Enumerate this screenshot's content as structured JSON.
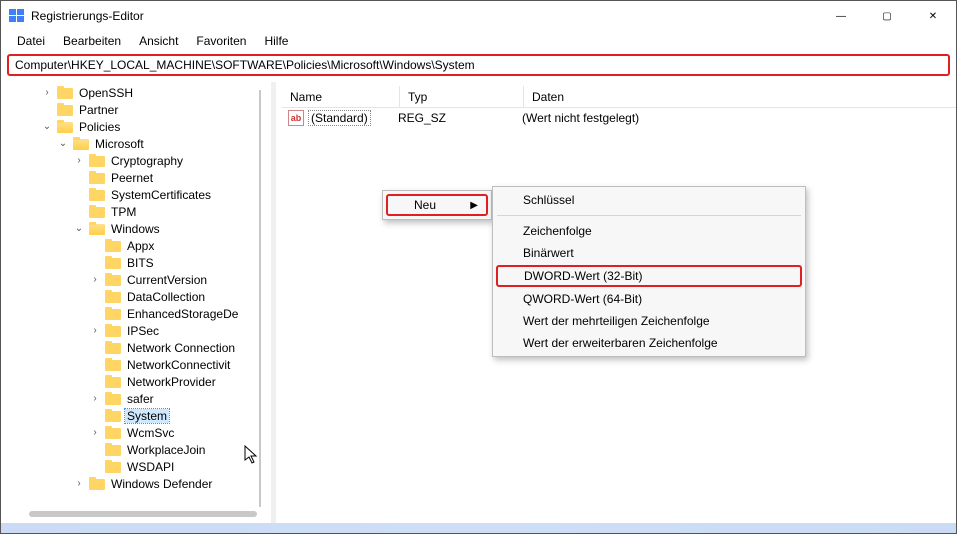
{
  "window": {
    "title": "Registrierungs-Editor",
    "minimize": "—",
    "maximize": "▢",
    "close": "✕"
  },
  "menu": {
    "file": "Datei",
    "edit": "Bearbeiten",
    "view": "Ansicht",
    "favorites": "Favoriten",
    "help": "Hilfe"
  },
  "address": {
    "value": "Computer\\HKEY_LOCAL_MACHINE\\SOFTWARE\\Policies\\Microsoft\\Windows\\System"
  },
  "columns": {
    "name": "Name",
    "type": "Typ",
    "data": "Daten"
  },
  "default_value": {
    "name": "(Standard)",
    "type": "REG_SZ",
    "data": "(Wert nicht festgelegt)"
  },
  "context_primary": {
    "neu": "Neu"
  },
  "context_sub": {
    "schluessel": "Schlüssel",
    "zeichenfolge": "Zeichenfolge",
    "binaer": "Binärwert",
    "dword32": "DWORD-Wert (32-Bit)",
    "qword64": "QWORD-Wert (64-Bit)",
    "multi": "Wert der mehrteiligen Zeichenfolge",
    "expand": "Wert der erweiterbaren Zeichenfolge"
  },
  "tree": {
    "openssh": "OpenSSH",
    "partner": "Partner",
    "policies": "Policies",
    "microsoft": "Microsoft",
    "cryptography": "Cryptography",
    "peernet": "Peernet",
    "systemcertificates": "SystemCertificates",
    "tpm": "TPM",
    "windows": "Windows",
    "appx": "Appx",
    "bits": "BITS",
    "currentversion": "CurrentVersion",
    "datacollection": "DataCollection",
    "enhancedstorage": "EnhancedStorageDe",
    "ipsec": "IPSec",
    "networkconnection": "Network Connection",
    "networkconnectivit": "NetworkConnectivit",
    "networkprovider": "NetworkProvider",
    "safer": "safer",
    "system": "System",
    "wcmsvc": "WcmSvc",
    "workplacejoin": "WorkplaceJoin",
    "wsdapi": "WSDAPI",
    "windowsdefender": "Windows Defender"
  }
}
